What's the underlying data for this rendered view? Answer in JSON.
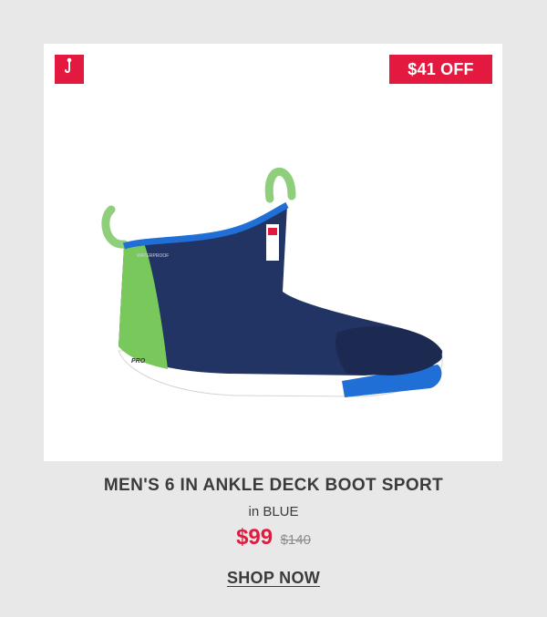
{
  "badge": {
    "discount_text": "$41 OFF"
  },
  "product": {
    "title": "MEN'S 6 IN ANKLE DECK BOOT SPORT",
    "color_text": "in BLUE",
    "price": "$99",
    "original_price": "$140",
    "image_text_waterproof": "WATERPROOF",
    "image_text_pro": "PRO"
  },
  "cta": {
    "label": "SHOP NOW"
  },
  "colors": {
    "accent": "#e3193f",
    "boot_navy": "#223463",
    "boot_blue": "#1f6fd6",
    "boot_green": "#79c85b"
  }
}
